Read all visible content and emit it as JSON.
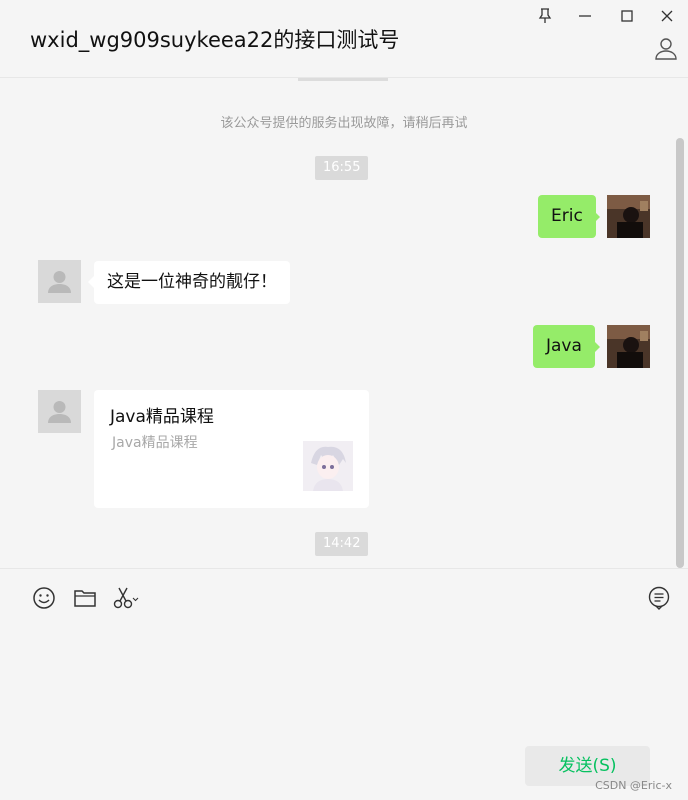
{
  "window": {
    "title": "wxid_wg909suykeea22的接口测试号",
    "pin_icon": "pin-icon",
    "minimize_icon": "minimize-icon",
    "maximize_icon": "maximize-icon",
    "close_icon": "close-icon",
    "profile_icon": "person-icon"
  },
  "chat": {
    "system_notice": "该公众号提供的服务出现故障，请稍后再试",
    "timestamps": [
      "16:55",
      "14:42"
    ],
    "messages": [
      {
        "from": "me",
        "text": "Eric"
      },
      {
        "from": "other",
        "text": "这是一位神奇的靓仔！"
      },
      {
        "from": "me",
        "text": "Java"
      }
    ],
    "card": {
      "title": "Java精品课程",
      "description": "Java精品课程"
    }
  },
  "toolbar": {
    "icons": [
      "emoji-icon",
      "folder-icon",
      "scissors-icon",
      "chat-history-icon"
    ]
  },
  "composer": {
    "value": "",
    "send_label": "发送(S)"
  },
  "watermark": "CSDN @Eric-x",
  "colors": {
    "my_bubble": "#95ec69",
    "other_bubble": "#ffffff",
    "send_text": "#07c160",
    "background": "#f5f5f5"
  }
}
